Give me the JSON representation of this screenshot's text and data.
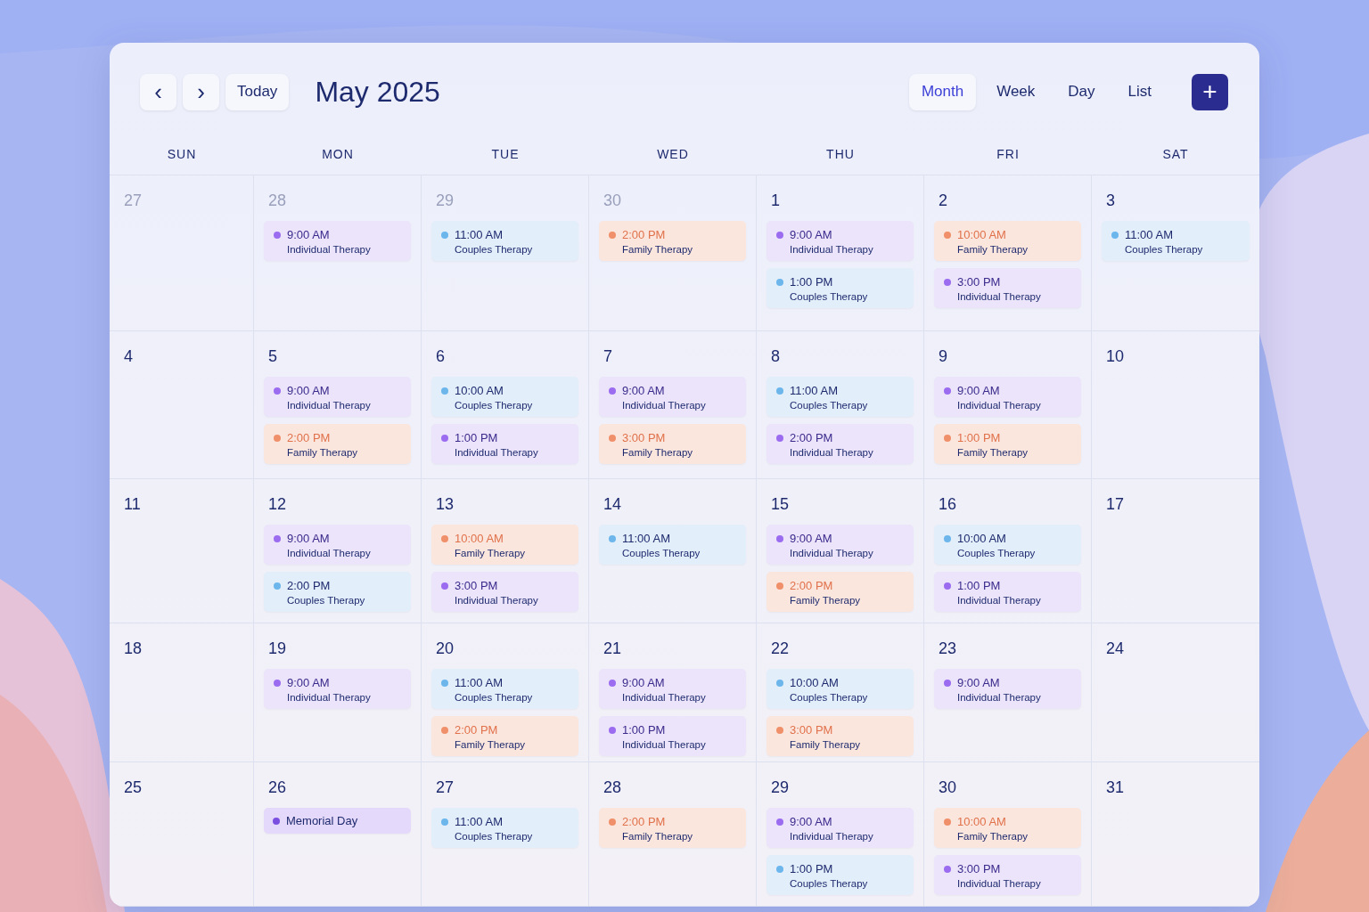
{
  "toolbar": {
    "prev": "‹",
    "next": "›",
    "today": "Today",
    "title": "May 2025",
    "views": [
      {
        "label": "Month",
        "selected": true
      },
      {
        "label": "Week",
        "selected": false
      },
      {
        "label": "Day",
        "selected": false
      },
      {
        "label": "List",
        "selected": false
      }
    ],
    "add": "+"
  },
  "weekdays": [
    "SUN",
    "MON",
    "TUE",
    "WED",
    "THU",
    "FRI",
    "SAT"
  ],
  "weeks": [
    [
      {
        "day": "27",
        "muted": true
      },
      {
        "day": "28",
        "muted": true,
        "events": [
          {
            "kind": "individual",
            "color": "#9b6cf0",
            "time": "9:00 AM",
            "title": "Individual Therapy"
          }
        ]
      },
      {
        "day": "29",
        "muted": true,
        "events": [
          {
            "kind": "couples",
            "color": "#6cb6ec",
            "time": "11:00 AM",
            "title": "Couples Therapy"
          }
        ]
      },
      {
        "day": "30",
        "muted": true,
        "events": [
          {
            "kind": "family",
            "color": "#f0906a",
            "time": "2:00 PM",
            "title": "Family Therapy"
          }
        ]
      },
      {
        "day": "1",
        "muted": false,
        "events": [
          {
            "kind": "individual",
            "color": "#9b6cf0",
            "time": "9:00 AM",
            "title": "Individual Therapy"
          },
          {
            "kind": "couples",
            "color": "#6cb6ec",
            "time": "1:00 PM",
            "title": "Couples Therapy"
          }
        ]
      },
      {
        "day": "2",
        "muted": false,
        "events": [
          {
            "kind": "family",
            "color": "#f0906a",
            "time": "10:00 AM",
            "title": "Family Therapy"
          },
          {
            "kind": "individual",
            "color": "#9b6cf0",
            "time": "3:00 PM",
            "title": "Individual Therapy"
          }
        ]
      },
      {
        "day": "3",
        "muted": false,
        "events": [
          {
            "kind": "couples",
            "color": "#6cb6ec",
            "time": "11:00 AM",
            "title": "Couples Therapy"
          }
        ]
      }
    ],
    [
      {
        "day": "4",
        "muted": false
      },
      {
        "day": "5",
        "muted": false,
        "events": [
          {
            "kind": "individual",
            "color": "#9b6cf0",
            "time": "9:00 AM",
            "title": "Individual Therapy"
          },
          {
            "kind": "family",
            "color": "#f0906a",
            "time": "2:00 PM",
            "title": "Family Therapy"
          }
        ]
      },
      {
        "day": "6",
        "muted": false,
        "events": [
          {
            "kind": "couples",
            "color": "#6cb6ec",
            "time": "10:00 AM",
            "title": "Couples Therapy"
          },
          {
            "kind": "individual",
            "color": "#9b6cf0",
            "time": "1:00 PM",
            "title": "Individual Therapy"
          }
        ]
      },
      {
        "day": "7",
        "muted": false,
        "events": [
          {
            "kind": "individual",
            "color": "#9b6cf0",
            "time": "9:00 AM",
            "title": "Individual Therapy"
          },
          {
            "kind": "family",
            "color": "#f0906a",
            "time": "3:00 PM",
            "title": "Family Therapy"
          }
        ]
      },
      {
        "day": "8",
        "muted": false,
        "events": [
          {
            "kind": "couples",
            "color": "#6cb6ec",
            "time": "11:00 AM",
            "title": "Couples Therapy"
          },
          {
            "kind": "individual",
            "color": "#9b6cf0",
            "time": "2:00 PM",
            "title": "Individual Therapy"
          }
        ]
      },
      {
        "day": "9",
        "muted": false,
        "events": [
          {
            "kind": "individual",
            "color": "#9b6cf0",
            "time": "9:00 AM",
            "title": "Individual Therapy"
          },
          {
            "kind": "family",
            "color": "#f0906a",
            "time": "1:00 PM",
            "title": "Family Therapy"
          }
        ]
      },
      {
        "day": "10",
        "muted": false
      }
    ],
    [
      {
        "day": "11",
        "muted": false
      },
      {
        "day": "12",
        "muted": false,
        "events": [
          {
            "kind": "individual",
            "color": "#9b6cf0",
            "time": "9:00 AM",
            "title": "Individual Therapy"
          },
          {
            "kind": "couples",
            "color": "#6cb6ec",
            "time": "2:00 PM",
            "title": "Couples Therapy"
          }
        ]
      },
      {
        "day": "13",
        "muted": false,
        "events": [
          {
            "kind": "family",
            "color": "#f0906a",
            "time": "10:00 AM",
            "title": "Family Therapy"
          },
          {
            "kind": "individual",
            "color": "#9b6cf0",
            "time": "3:00 PM",
            "title": "Individual Therapy"
          }
        ]
      },
      {
        "day": "14",
        "muted": false,
        "events": [
          {
            "kind": "couples",
            "color": "#6cb6ec",
            "time": "11:00 AM",
            "title": "Couples Therapy"
          }
        ]
      },
      {
        "day": "15",
        "muted": false,
        "events": [
          {
            "kind": "individual",
            "color": "#9b6cf0",
            "time": "9:00 AM",
            "title": "Individual Therapy"
          },
          {
            "kind": "family",
            "color": "#f0906a",
            "time": "2:00 PM",
            "title": "Family Therapy"
          }
        ]
      },
      {
        "day": "16",
        "muted": false,
        "events": [
          {
            "kind": "couples",
            "color": "#6cb6ec",
            "time": "10:00 AM",
            "title": "Couples Therapy"
          },
          {
            "kind": "individual",
            "color": "#9b6cf0",
            "time": "1:00 PM",
            "title": "Individual Therapy"
          }
        ]
      },
      {
        "day": "17",
        "muted": false
      }
    ],
    [
      {
        "day": "18",
        "muted": false
      },
      {
        "day": "19",
        "muted": false,
        "events": [
          {
            "kind": "individual",
            "color": "#9b6cf0",
            "time": "9:00 AM",
            "title": "Individual Therapy"
          }
        ]
      },
      {
        "day": "20",
        "muted": false,
        "events": [
          {
            "kind": "couples",
            "color": "#6cb6ec",
            "time": "11:00 AM",
            "title": "Couples Therapy"
          },
          {
            "kind": "family",
            "color": "#f0906a",
            "time": "2:00 PM",
            "title": "Family Therapy"
          }
        ]
      },
      {
        "day": "21",
        "muted": false,
        "events": [
          {
            "kind": "individual",
            "color": "#9b6cf0",
            "time": "9:00 AM",
            "title": "Individual Therapy"
          },
          {
            "kind": "individual",
            "color": "#9b6cf0",
            "time": "1:00 PM",
            "title": "Individual Therapy"
          }
        ]
      },
      {
        "day": "22",
        "muted": false,
        "events": [
          {
            "kind": "couples",
            "color": "#6cb6ec",
            "time": "10:00 AM",
            "title": "Couples Therapy"
          },
          {
            "kind": "family",
            "color": "#f0906a",
            "time": "3:00 PM",
            "title": "Family Therapy"
          }
        ]
      },
      {
        "day": "23",
        "muted": false,
        "events": [
          {
            "kind": "individual",
            "color": "#9b6cf0",
            "time": "9:00 AM",
            "title": "Individual Therapy"
          }
        ]
      },
      {
        "day": "24",
        "muted": false
      }
    ],
    [
      {
        "day": "25",
        "muted": false
      },
      {
        "day": "26",
        "muted": false,
        "events": [
          {
            "kind": "holiday",
            "color": "#7b4fe0",
            "title": "Memorial Day"
          }
        ]
      },
      {
        "day": "27",
        "muted": false,
        "events": [
          {
            "kind": "couples",
            "color": "#6cb6ec",
            "time": "11:00 AM",
            "title": "Couples Therapy"
          }
        ]
      },
      {
        "day": "28",
        "muted": false,
        "events": [
          {
            "kind": "family",
            "color": "#f0906a",
            "time": "2:00 PM",
            "title": "Family Therapy"
          }
        ]
      },
      {
        "day": "29",
        "muted": false,
        "events": [
          {
            "kind": "individual",
            "color": "#9b6cf0",
            "time": "9:00 AM",
            "title": "Individual Therapy"
          },
          {
            "kind": "couples",
            "color": "#6cb6ec",
            "time": "1:00 PM",
            "title": "Couples Therapy"
          }
        ]
      },
      {
        "day": "30",
        "muted": false,
        "events": [
          {
            "kind": "family",
            "color": "#f0906a",
            "time": "10:00 AM",
            "title": "Family Therapy"
          },
          {
            "kind": "individual",
            "color": "#9b6cf0",
            "time": "3:00 PM",
            "title": "Individual Therapy"
          }
        ]
      },
      {
        "day": "31",
        "muted": false
      }
    ]
  ]
}
